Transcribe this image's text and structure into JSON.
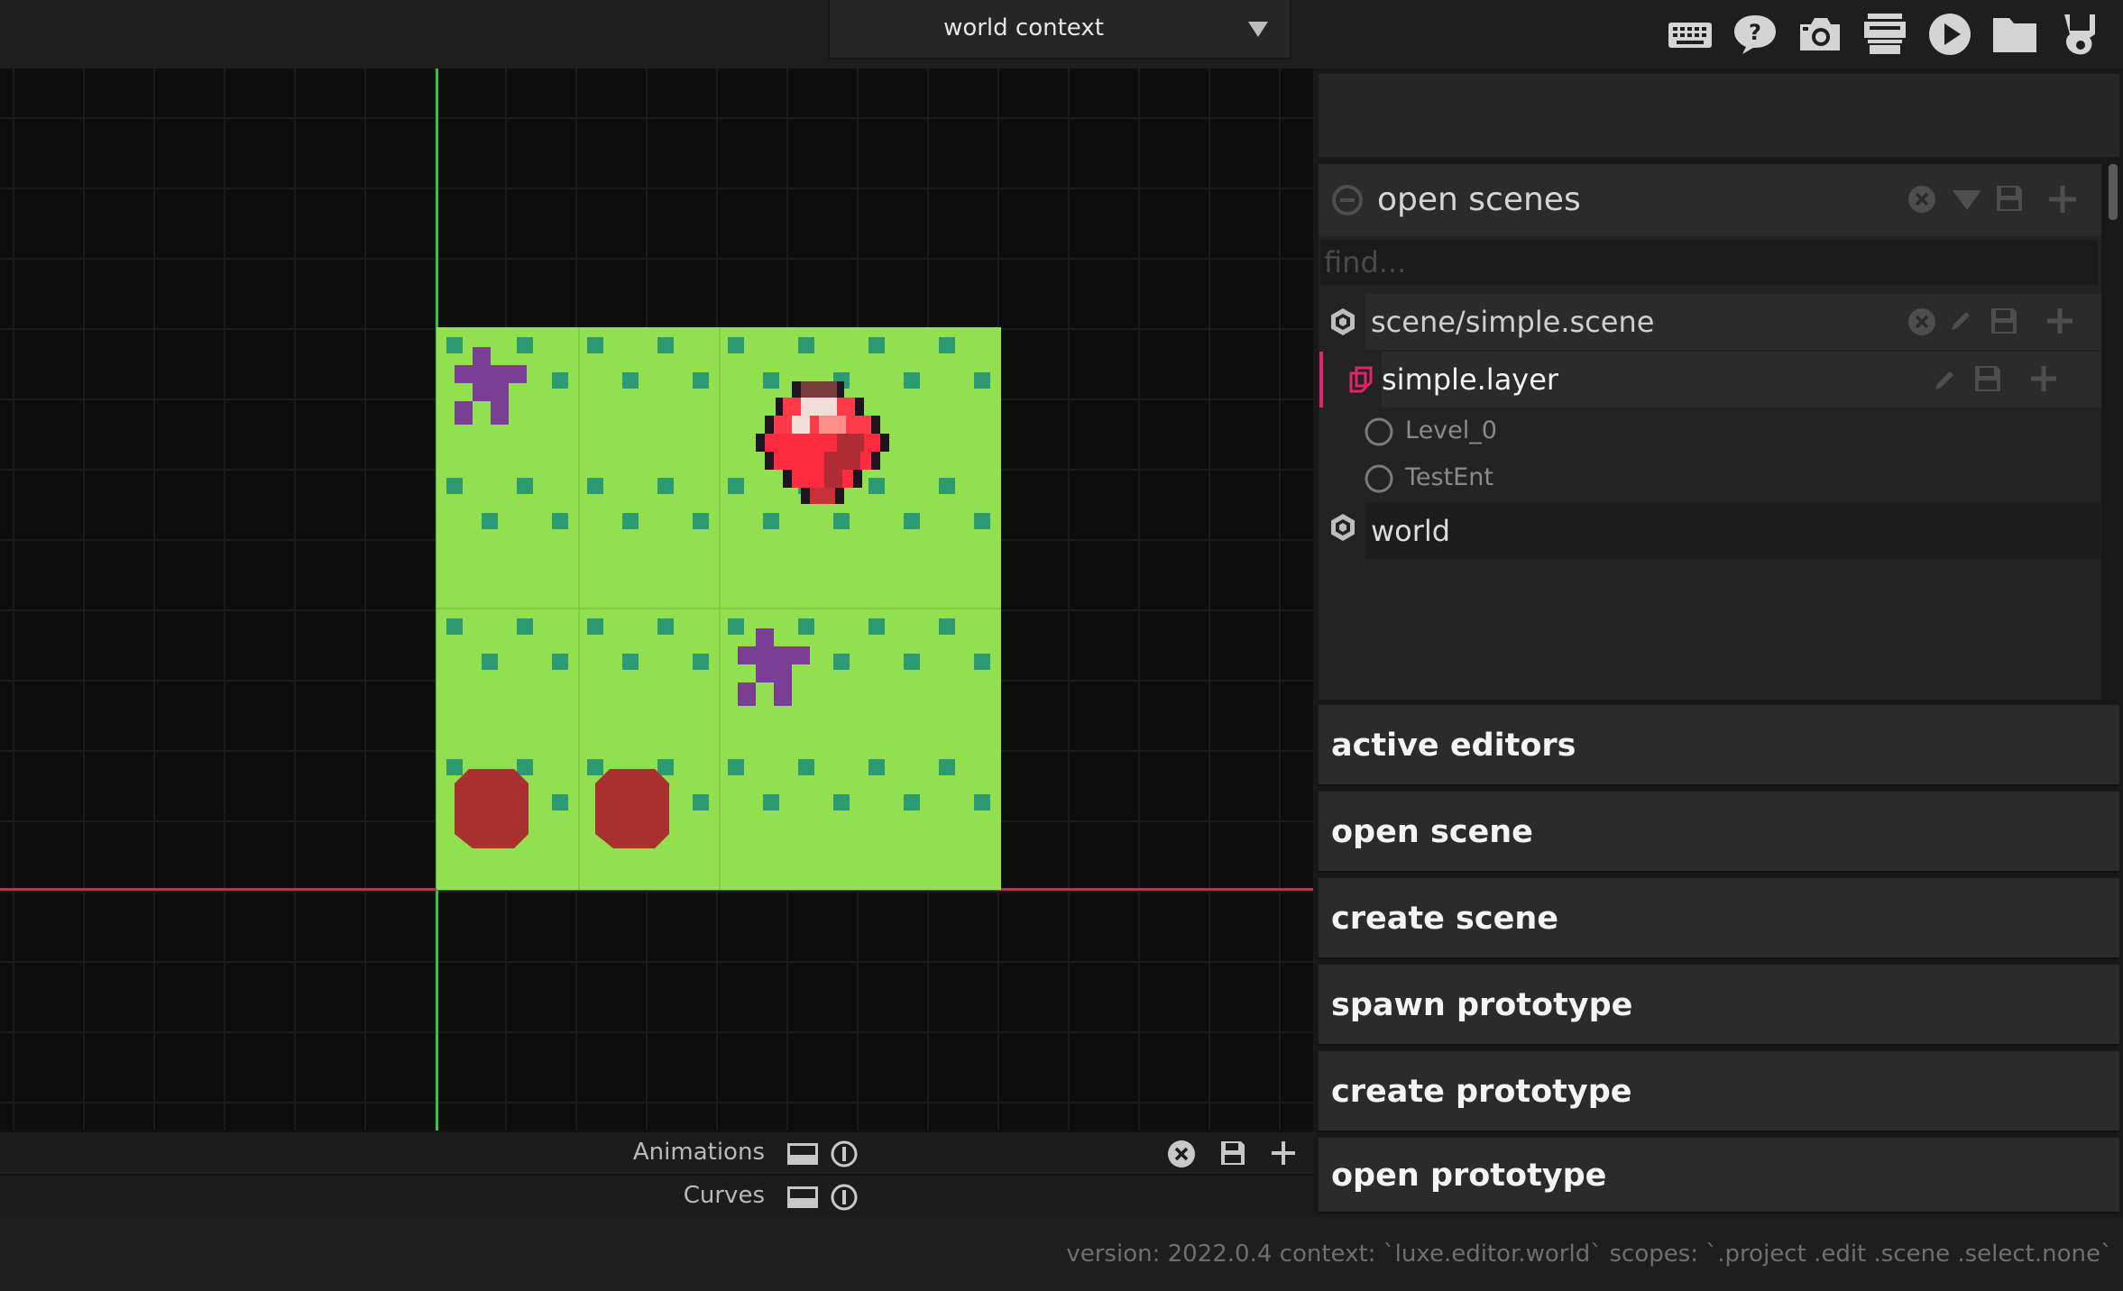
{
  "topbar": {
    "context_label": "world context",
    "icons": [
      "keyboard-icon",
      "help-icon",
      "camera-icon",
      "console-icon",
      "play-icon",
      "folder-icon",
      "luxe-logo-icon"
    ]
  },
  "viewport": {
    "axis_x_color": "#d8204b",
    "axis_y_color": "#39c23a",
    "grass_color": "#92e04f",
    "dot_color": "#2c9a72"
  },
  "bottom_tracks": {
    "animations_label": "Animations",
    "curves_label": "Curves"
  },
  "scenes_panel": {
    "title": "open scenes",
    "find_placeholder": "find...",
    "items": [
      {
        "label": "scene/simple.scene",
        "kind": "scene"
      },
      {
        "label": "simple.layer",
        "kind": "layer"
      },
      {
        "label": "Level_0",
        "kind": "entity"
      },
      {
        "label": "TestEnt",
        "kind": "entity"
      },
      {
        "label": "world",
        "kind": "world"
      }
    ]
  },
  "actions": [
    {
      "label": "active editors"
    },
    {
      "label": "open scene"
    },
    {
      "label": "create scene"
    },
    {
      "label": "spawn prototype"
    },
    {
      "label": "create prototype"
    },
    {
      "label": "open prototype"
    }
  ],
  "status": {
    "text": "version: 2022.0.4 context: `luxe.editor.world` scopes: `.project .edit .scene .select.none`"
  },
  "colors": {
    "accent_layer": "#e0236b",
    "background": "#1e1e1f"
  }
}
